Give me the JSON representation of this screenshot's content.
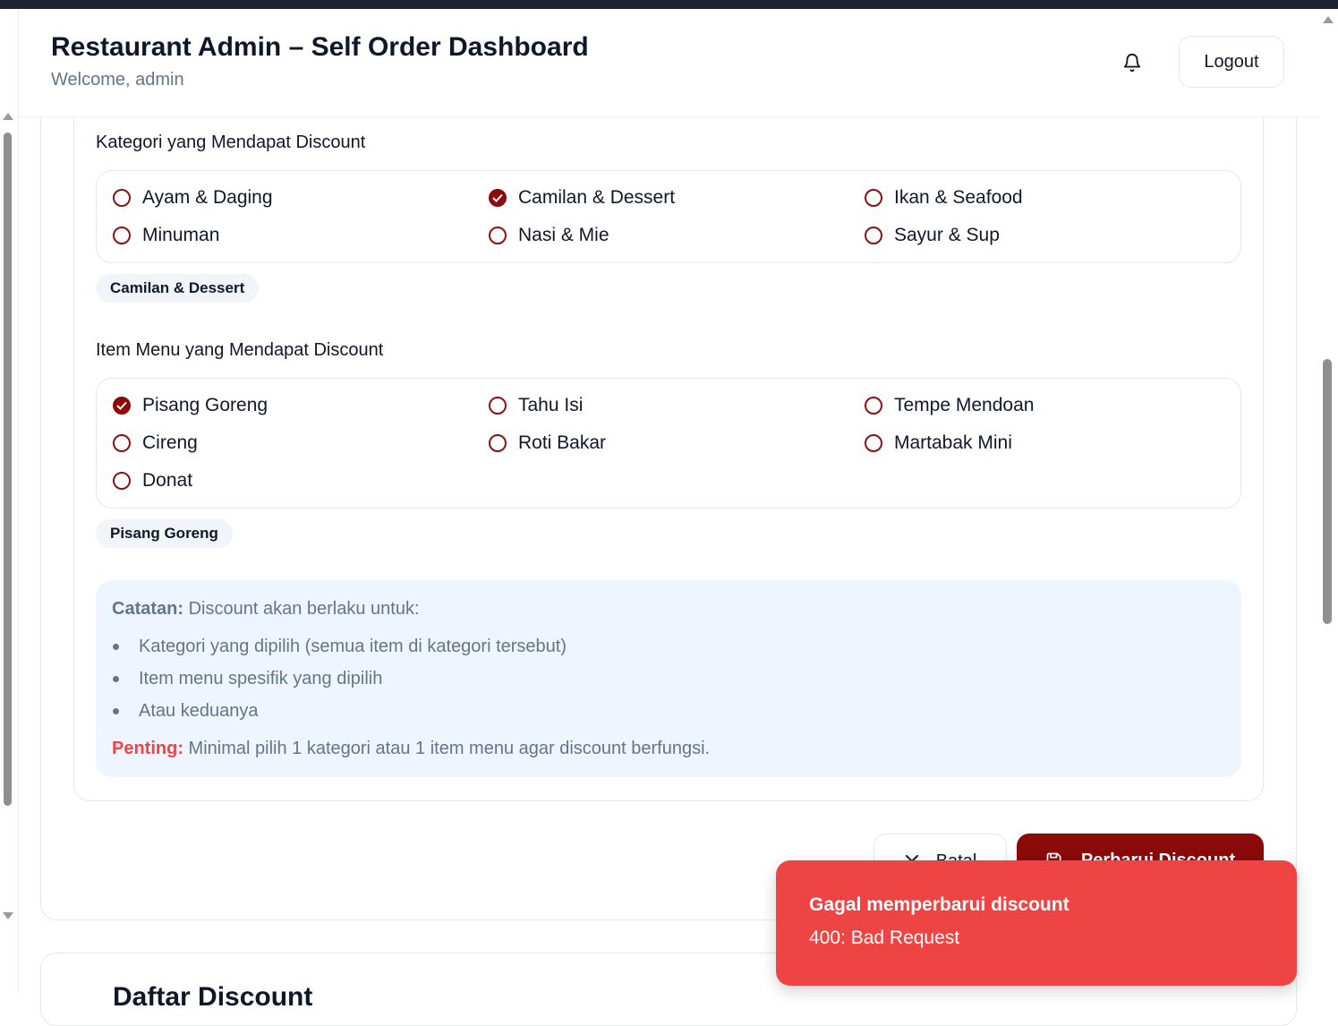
{
  "header": {
    "title": "Restaurant Admin – Self Order Dashboard",
    "subtitle": "Welcome, admin",
    "logout_label": "Logout",
    "bell_icon": "bell-icon"
  },
  "categories_section": {
    "label": "Kategori yang Mendapat Discount",
    "options": [
      {
        "label": "Ayam & Daging",
        "checked": false
      },
      {
        "label": "Camilan & Dessert",
        "checked": true
      },
      {
        "label": "Ikan & Seafood",
        "checked": false
      },
      {
        "label": "Minuman",
        "checked": false
      },
      {
        "label": "Nasi & Mie",
        "checked": false
      },
      {
        "label": "Sayur & Sup",
        "checked": false
      }
    ],
    "selected_chips": [
      "Camilan & Dessert"
    ]
  },
  "items_section": {
    "label": "Item Menu yang Mendapat Discount",
    "options": [
      {
        "label": "Pisang Goreng",
        "checked": true
      },
      {
        "label": "Tahu Isi",
        "checked": false
      },
      {
        "label": "Tempe Mendoan",
        "checked": false
      },
      {
        "label": "Cireng",
        "checked": false
      },
      {
        "label": "Roti Bakar",
        "checked": false
      },
      {
        "label": "Martabak Mini",
        "checked": false
      },
      {
        "label": "Donat",
        "checked": false
      }
    ],
    "selected_chips": [
      "Pisang Goreng"
    ]
  },
  "note": {
    "heading": "Catatan:",
    "intro": " Discount akan berlaku untuk:",
    "bullets": [
      "Kategori yang dipilih (semua item di kategori tersebut)",
      "Item menu spesifik yang dipilih",
      "Atau keduanya"
    ],
    "warning_label": "Penting:",
    "warning_text": " Minimal pilih 1 kategori atau 1 item menu agar discount berfungsi."
  },
  "actions": {
    "cancel_label": "Batal",
    "save_label": "Perbarui Discount"
  },
  "next_section": {
    "title": "Daftar Discount"
  },
  "toast": {
    "title": "Gagal memperbarui discount",
    "message": "400: Bad Request"
  },
  "colors": {
    "brand": "#8b0a0a",
    "error": "#ef4444",
    "note_bg": "#eef5ff"
  }
}
